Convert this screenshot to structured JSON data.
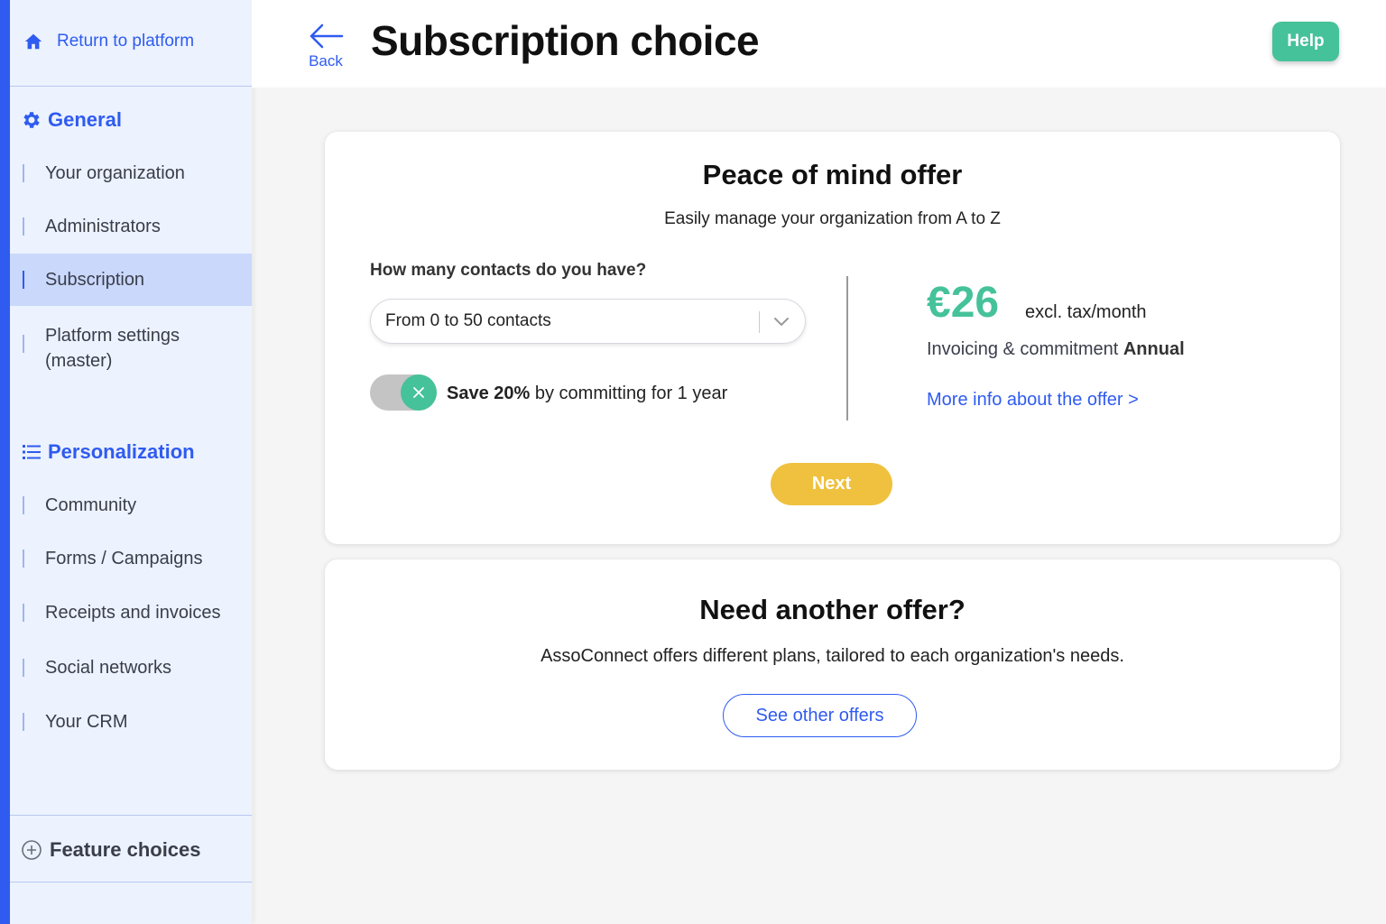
{
  "sidebar": {
    "return_label": "Return to platform",
    "sections": {
      "general": {
        "title": "General",
        "items": [
          "Your organization",
          "Administrators",
          "Subscription",
          "Platform settings (master)"
        ]
      },
      "personalization": {
        "title": "Personalization",
        "items": [
          "Community",
          "Forms / Campaigns",
          "Receipts and invoices",
          "Social networks",
          "Your CRM"
        ]
      }
    },
    "active_item": "Subscription",
    "feature_choices": "Feature choices"
  },
  "header": {
    "back_label": "Back",
    "title": "Subscription choice",
    "help_label": "Help"
  },
  "offer": {
    "title": "Peace of mind offer",
    "subtitle": "Easily manage your organization from A to Z",
    "contacts_question": "How many contacts do you have?",
    "contacts_selected": "From 0 to 50 contacts",
    "commit_toggle_on": true,
    "commit_bold": "Save 20%",
    "commit_rest": " by committing for 1 year",
    "price": "€26",
    "price_unit": "excl. tax/month",
    "billing_prefix": "Invoicing & commitment ",
    "billing_value": "Annual",
    "more_info": "More info about the offer >",
    "next_label": "Next"
  },
  "other": {
    "title": "Need another offer?",
    "subtitle": "AssoConnect offers different plans, tailored to each organization's needs.",
    "button_label": "See other offers"
  },
  "colors": {
    "accent_blue": "#2f5bf0",
    "green": "#45c29a",
    "yellow": "#efc13f",
    "sidebar_bg": "#ecf2fe",
    "active_bg": "#c9d8fb"
  },
  "icons": {
    "return": "home-icon",
    "general": "gear-icon",
    "personalization": "list-icon",
    "feature_choices": "plus-circle-icon",
    "back": "arrow-left-icon",
    "select": "chevron-down-icon",
    "toggle": "close-icon"
  }
}
